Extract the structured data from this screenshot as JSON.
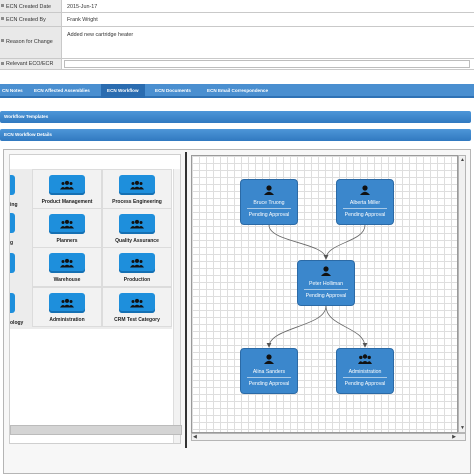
{
  "form": {
    "rows": [
      {
        "label": "ECN Created Date",
        "value": "2015-Jun-17"
      },
      {
        "label": "ECN Created By",
        "value": "Frank Wright"
      },
      {
        "label": "Reason for Change",
        "value": "Added new cartridge heater"
      },
      {
        "label": "Relevant ECO/ECR",
        "value": ""
      }
    ]
  },
  "tabs": [
    {
      "label": "CN Notes",
      "active": false
    },
    {
      "label": "ECN Affected Assemblies",
      "active": false
    },
    {
      "label": "ECN Workflow",
      "active": true
    },
    {
      "label": "ECN Documents",
      "active": false
    },
    {
      "label": "ECN Email Correspondence",
      "active": false
    }
  ],
  "panels": {
    "templates": "Workflow Templates",
    "details": "ECN Workflow Details"
  },
  "palette": {
    "left_labels": [
      "ing",
      "g",
      "",
      "ology"
    ],
    "cells": [
      {
        "label": "Product Management"
      },
      {
        "label": "Process Engineering"
      },
      {
        "label": "Planners"
      },
      {
        "label": "Quality Assurance"
      },
      {
        "label": "Warehouse"
      },
      {
        "label": "Production"
      },
      {
        "label": "Administration"
      },
      {
        "label": "CRM Test Category"
      }
    ]
  },
  "workflow": {
    "nodes": [
      {
        "id": "n1",
        "name": "Bruce Truong",
        "status": "Pending Approval",
        "icon": "user-icon"
      },
      {
        "id": "n2",
        "name": "Alberta Miller",
        "status": "Pending Approval",
        "icon": "user-icon"
      },
      {
        "id": "n3",
        "name": "Peter Holliman",
        "status": "Pending Approval",
        "icon": "user-icon"
      },
      {
        "id": "n4",
        "name": "Alina Sanders",
        "status": "Pending Approval",
        "icon": "user-icon"
      },
      {
        "id": "n5",
        "name": "Administration",
        "status": "Pending Approval",
        "icon": "group-icon"
      }
    ],
    "edges": [
      [
        "n1",
        "n3"
      ],
      [
        "n2",
        "n3"
      ],
      [
        "n3",
        "n4"
      ],
      [
        "n3",
        "n5"
      ]
    ]
  },
  "colors": {
    "accent": "#3b87cc",
    "tab_bar": "#4a8fd0",
    "palette_button": "#1e8fdc"
  }
}
